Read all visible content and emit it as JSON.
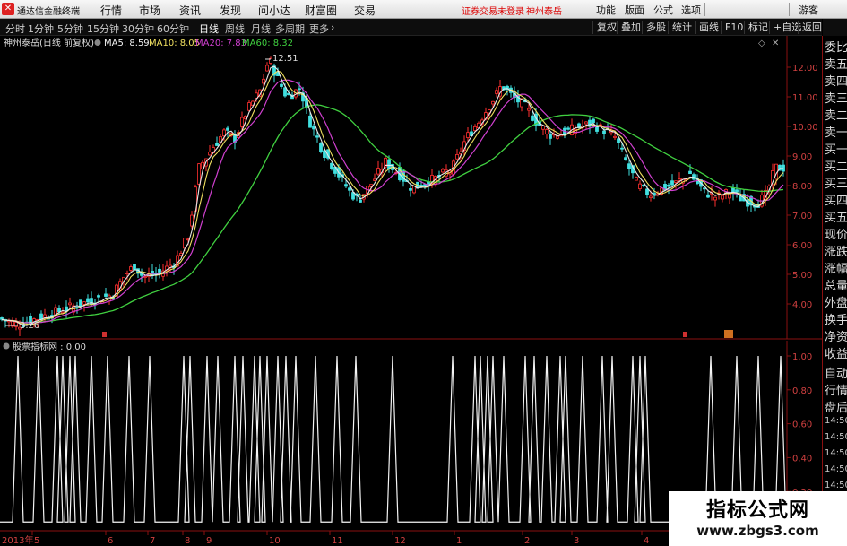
{
  "app": {
    "title": "通达信金融终端"
  },
  "menu": [
    "行情",
    "市场",
    "资讯",
    "发现",
    "问小达",
    "财富圈",
    "交易"
  ],
  "status": {
    "login": "证券交易未登录",
    "stock": "神州泰岳"
  },
  "right_buttons": [
    "功能",
    "版面",
    "公式",
    "选项",
    "游客"
  ],
  "periods": [
    "分时",
    "1分钟",
    "5分钟",
    "15分钟",
    "30分钟",
    "60分钟",
    "日线",
    "周线",
    "月线",
    "多周期",
    "更多"
  ],
  "active_period": "日线",
  "tools": [
    "复权",
    "叠加",
    "多股",
    "统计",
    "画线",
    "F10",
    "标记",
    "+自选",
    "返回"
  ],
  "main_chart": {
    "label": "神州泰岳(日线 前复权)",
    "ma": [
      {
        "name": "MA5",
        "value": "8.59",
        "color": "#f2f2f2"
      },
      {
        "name": "MA10",
        "value": "8.05",
        "color": "#f0e060"
      },
      {
        "name": "MA20",
        "value": "7.83",
        "color": "#d040d0"
      },
      {
        "name": "MA60",
        "value": "8.32",
        "color": "#40d040"
      }
    ],
    "high_marker": "12.51",
    "low_marker": "3.26",
    "y_ticks": [
      "12.00",
      "11.00",
      "10.00",
      "9.00",
      "8.00",
      "7.00",
      "6.00",
      "5.00",
      "4.00"
    ]
  },
  "indicator": {
    "label": "股票指标网 : 0.00",
    "y_ticks": [
      "1.00",
      "0.80",
      "0.60",
      "0.40",
      "0.20"
    ]
  },
  "x_axis": [
    "2013年",
    "5",
    "6",
    "7",
    "8",
    "9",
    "10",
    "11",
    "12",
    "1",
    "2",
    "3",
    "4"
  ],
  "side_panel": [
    "委比",
    "卖五",
    "卖四",
    "卖三",
    "卖二",
    "卖一",
    "买一",
    "买二",
    "买三",
    "买四",
    "买五",
    "现价",
    "涨跌",
    "涨幅",
    "总量",
    "外盘",
    "换手",
    "净资",
    "收益",
    "自动",
    "行情",
    "盘后",
    "14:50",
    "14:50",
    "14:50",
    "14:50",
    "14:50",
    "14:50"
  ],
  "watermark": {
    "line1": "指标公式网",
    "line2": "www.zbgs3.com"
  },
  "colors": {
    "up": "#ff3030",
    "down": "#40e0e0",
    "spike": "#ffffff",
    "axis": "#8a1010"
  }
}
